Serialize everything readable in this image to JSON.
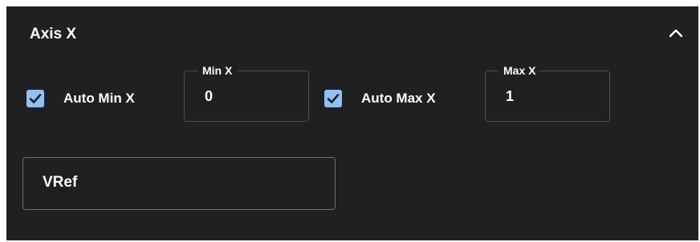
{
  "panel": {
    "title": "Axis X",
    "collapse_icon": "chevron-up-icon"
  },
  "auto_min": {
    "label": "Auto Min X",
    "checked": true
  },
  "min_field": {
    "label": "Min X",
    "value": "0"
  },
  "auto_max": {
    "label": "Auto Max X",
    "checked": true
  },
  "max_field": {
    "label": "Max X",
    "value": "1"
  },
  "vref_field": {
    "value": "VRef"
  },
  "colors": {
    "panel_bg": "#1f2021",
    "checkbox_accent": "#8ec1f5",
    "field_border": "#4b4d50"
  }
}
